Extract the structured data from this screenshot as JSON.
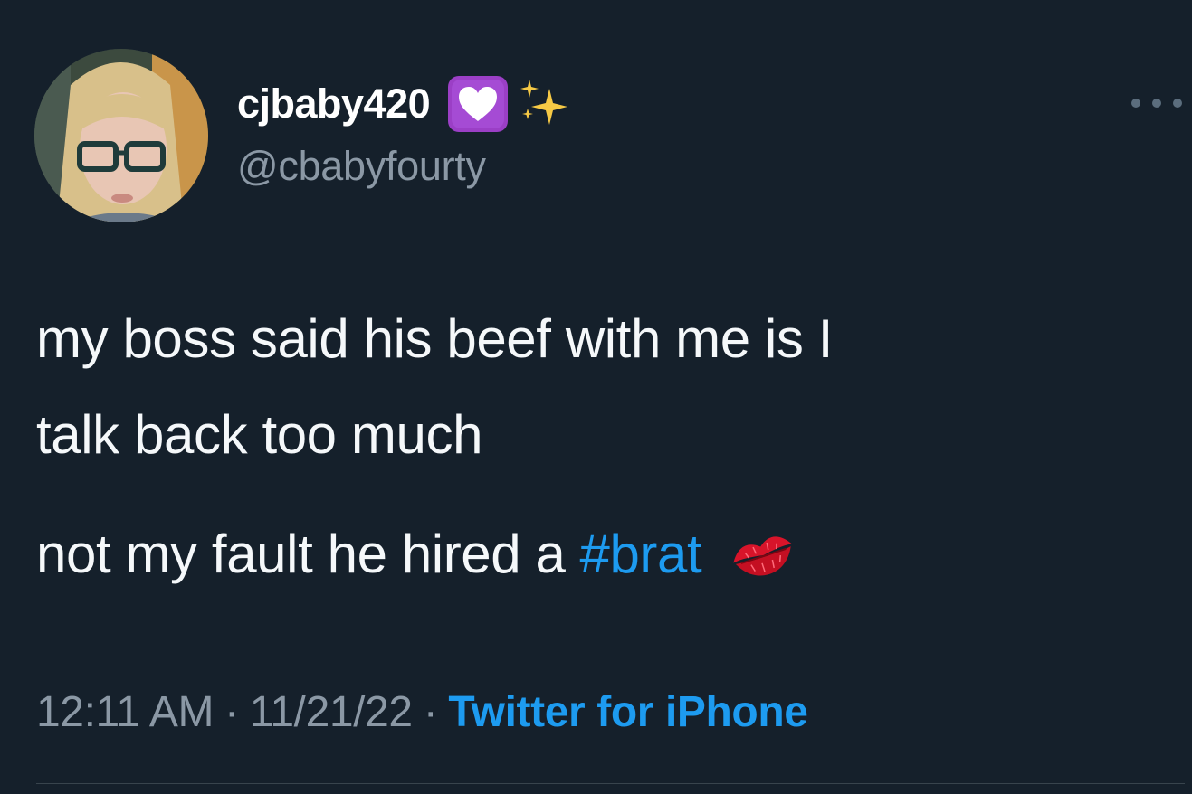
{
  "tweet": {
    "author": {
      "display_name": "cjbaby420",
      "handle": "@cbabyfourty",
      "avatar": "avatar-photo",
      "badges": [
        "heart-decoration-icon",
        "sparkles-icon"
      ]
    },
    "text": {
      "line1": "my boss said his beef with me is I",
      "line2": "talk back too much",
      "line3_prefix": "not my fault he hired a",
      "hashtag": "#brat",
      "trailing_emoji": "kiss-mark-icon"
    },
    "meta": {
      "time": "12:11 AM",
      "separator": "·",
      "date": "11/21/22",
      "source": "Twitter for iPhone"
    }
  },
  "colors": {
    "background": "#15202b",
    "text_primary": "#f5f8fa",
    "text_secondary": "#8b98a5",
    "accent": "#1d9bf0",
    "divider": "#38444d"
  }
}
